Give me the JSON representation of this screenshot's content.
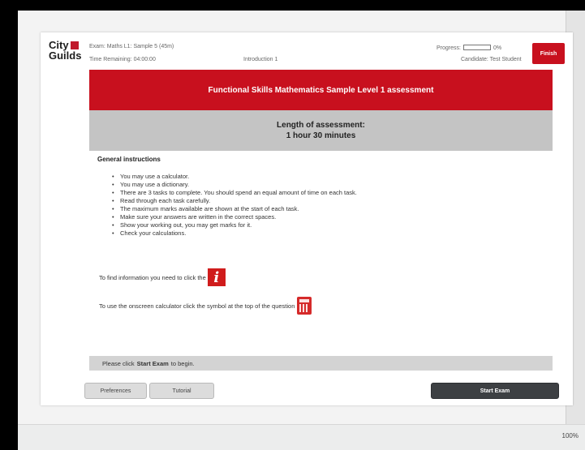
{
  "header": {
    "logo_line1": "City",
    "logo_line2": "Guilds",
    "exam_label": "Exam: Maths L1: Sample 5 (45m)",
    "time_label": "Time Remaining: 04:00:00",
    "section_label": "Introduction 1",
    "progress_label": "Progress:",
    "progress_percent": "0%",
    "progress_value": 0,
    "candidate_label": "Candidate: Test Student",
    "finish_label": "Finish"
  },
  "content": {
    "banner_title": "Functional Skills Mathematics Sample Level 1 assessment",
    "length_line1": "Length of assessment:",
    "length_line2": "1 hour 30 minutes",
    "section_title": "General instructions",
    "instructions": [
      "You may use a calculator.",
      "You may use a dictionary.",
      "There are 3 tasks to complete. You should spend an equal amount of time on each task.",
      "Read through each task carefully.",
      "The maximum marks available are shown at the start of each task.",
      "Make sure your answers are written in the correct spaces.",
      "Show your working out, you may get marks for it.",
      "Check your calculations."
    ],
    "info_text": "To find information you need to click the",
    "info_icon_glyph": "i",
    "calc_text": "To use the onscreen calculator click the symbol at the top of the question",
    "start_prefix": "Please click",
    "start_bold": "Start Exam",
    "start_suffix": "to begin."
  },
  "footer": {
    "preferences_label": "Preferences",
    "tutorial_label": "Tutorial",
    "start_exam_label": "Start Exam"
  },
  "statusbar": {
    "zoom": "100%"
  },
  "colors": {
    "brand_red": "#c8101e",
    "dark_button": "#3d4043"
  }
}
